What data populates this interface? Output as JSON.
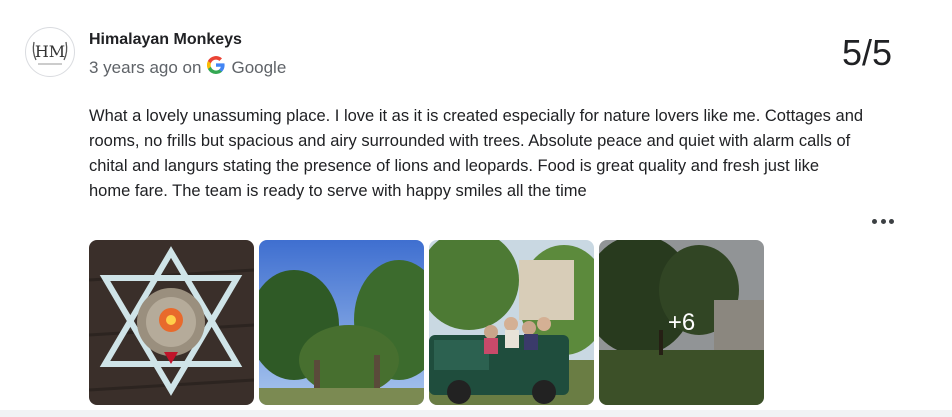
{
  "review": {
    "author": "Himalayan Monkeys",
    "time": "3 years ago on",
    "source": "Google",
    "score": "5/5",
    "text": "What a lovely unassuming place. I love it as it is created especially for nature lovers like me. Cottages and rooms, no frills but spacious and airy surrounded with trees. Absolute peace and quiet with alarm calls of chital and langurs stating the presence of lions and leopards. Food is great quality and fresh just like home fare. The team is ready to serve with happy smiles all the time",
    "more_photos": "+6",
    "icons": {
      "source_logo": "google-logo-icon",
      "menu": "more-horizontal-icon"
    },
    "colors": {
      "google_blue": "#4285F4",
      "google_red": "#EA4335",
      "google_yellow": "#FBBC05",
      "google_green": "#34A853"
    }
  }
}
